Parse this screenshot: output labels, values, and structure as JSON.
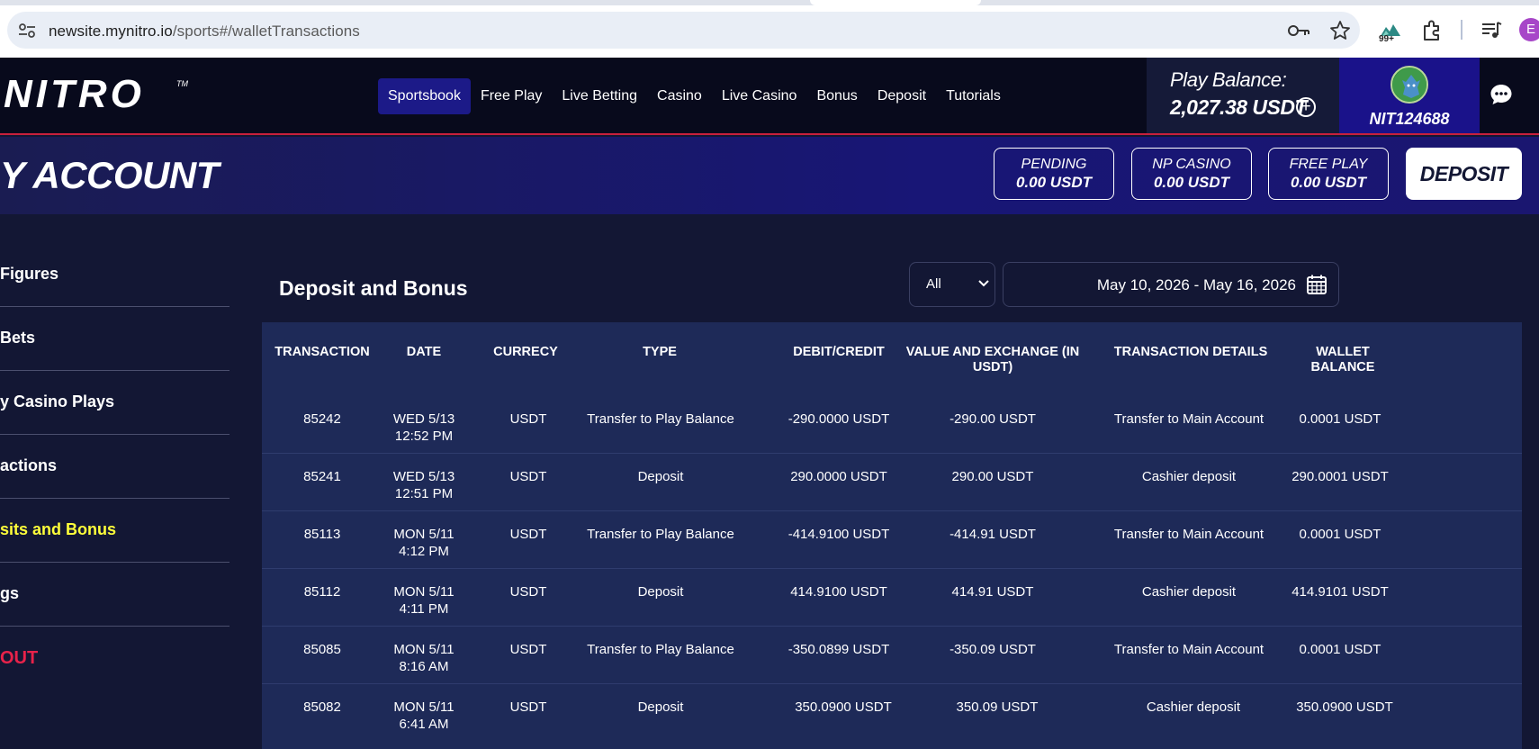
{
  "browser": {
    "url_host": "newsite.mynitro.io",
    "url_path": "/sports#/walletTransactions",
    "extension_badge": "99+",
    "profile_initial": "E"
  },
  "header": {
    "logo": "NITRO",
    "logo_tm": "TM",
    "nav": [
      {
        "label": "Sportsbook",
        "active": true
      },
      {
        "label": "Free Play",
        "active": false
      },
      {
        "label": "Live Betting",
        "active": false
      },
      {
        "label": "Casino",
        "active": false
      },
      {
        "label": "Live Casino",
        "active": false
      },
      {
        "label": "Bonus",
        "active": false
      },
      {
        "label": "Deposit",
        "active": false
      },
      {
        "label": "Tutorials",
        "active": false
      }
    ],
    "balance_label": "Play Balance:",
    "balance_value": "2,027.38 USDT",
    "balance_plus": "+",
    "username": "NIT124688"
  },
  "account": {
    "title": "Y ACCOUNT",
    "stats": [
      {
        "label": "PENDING",
        "value": "0.00 USDT"
      },
      {
        "label": "NP CASINO",
        "value": "0.00 USDT"
      },
      {
        "label": "FREE PLAY",
        "value": "0.00 USDT"
      }
    ],
    "deposit_label": "DEPOSIT"
  },
  "sidebar": {
    "items": [
      {
        "label": "Figures",
        "active": false
      },
      {
        "label": "Bets",
        "active": false
      },
      {
        "label": "y Casino Plays",
        "active": false
      },
      {
        "label": "actions",
        "active": false
      },
      {
        "label": "sits and Bonus",
        "active": true
      },
      {
        "label": "gs",
        "active": false
      }
    ],
    "logout": "OUT"
  },
  "main": {
    "title": "Deposit and Bonus",
    "filter_value": "All",
    "date_range": "May 10, 2026 - May 16, 2026",
    "columns": [
      "TRANSACTION",
      "DATE",
      "CURRECY",
      "TYPE",
      "DEBIT/CREDIT",
      "VALUE AND EXCHANGE (IN USDT)",
      "TRANSACTION DETAILS",
      "WALLET BALANCE"
    ],
    "rows": [
      {
        "id": "85242",
        "date1": "WED 5/13",
        "date2": "12:52 PM",
        "currency": "USDT",
        "type": "Transfer to Play Balance",
        "debit": "-290.0000 USDT",
        "value": "-290.00 USDT",
        "details": "Transfer to Main Account",
        "balance": "0.0001 USDT"
      },
      {
        "id": "85241",
        "date1": "WED 5/13",
        "date2": "12:51 PM",
        "currency": "USDT",
        "type": "Deposit",
        "debit": "290.0000 USDT",
        "value": "290.00 USDT",
        "details": "Cashier deposit",
        "balance": "290.0001 USDT"
      },
      {
        "id": "85113",
        "date1": "MON 5/11",
        "date2": "4:12 PM",
        "currency": "USDT",
        "type": "Transfer to Play Balance",
        "debit": "-414.9100 USDT",
        "value": "-414.91 USDT",
        "details": "Transfer to Main Account",
        "balance": "0.0001 USDT"
      },
      {
        "id": "85112",
        "date1": "MON 5/11",
        "date2": "4:11 PM",
        "currency": "USDT",
        "type": "Deposit",
        "debit": "414.9100 USDT",
        "value": "414.91 USDT",
        "details": "Cashier deposit",
        "balance": "414.9101 USDT"
      },
      {
        "id": "85085",
        "date1": "MON 5/11",
        "date2": "8:16 AM",
        "currency": "USDT",
        "type": "Transfer to Play Balance",
        "debit": "-350.0899 USDT",
        "value": "-350.09 USDT",
        "details": "Transfer to Main Account",
        "balance": "0.0001 USDT"
      },
      {
        "id": "85082",
        "date1": "MON 5/11",
        "date2": "6:41 AM",
        "currency": "USDT",
        "type": "Deposit",
        "debit": "350.0900 USDT",
        "value": "350.09 USDT",
        "details": "Cashier deposit",
        "balance": "350.0900 USDT"
      }
    ]
  },
  "colors": {
    "accent_nav": "#1c1a88",
    "active_sidebar": "#ffff3a",
    "logout": "#e8224a",
    "header_border": "#c8203c"
  }
}
